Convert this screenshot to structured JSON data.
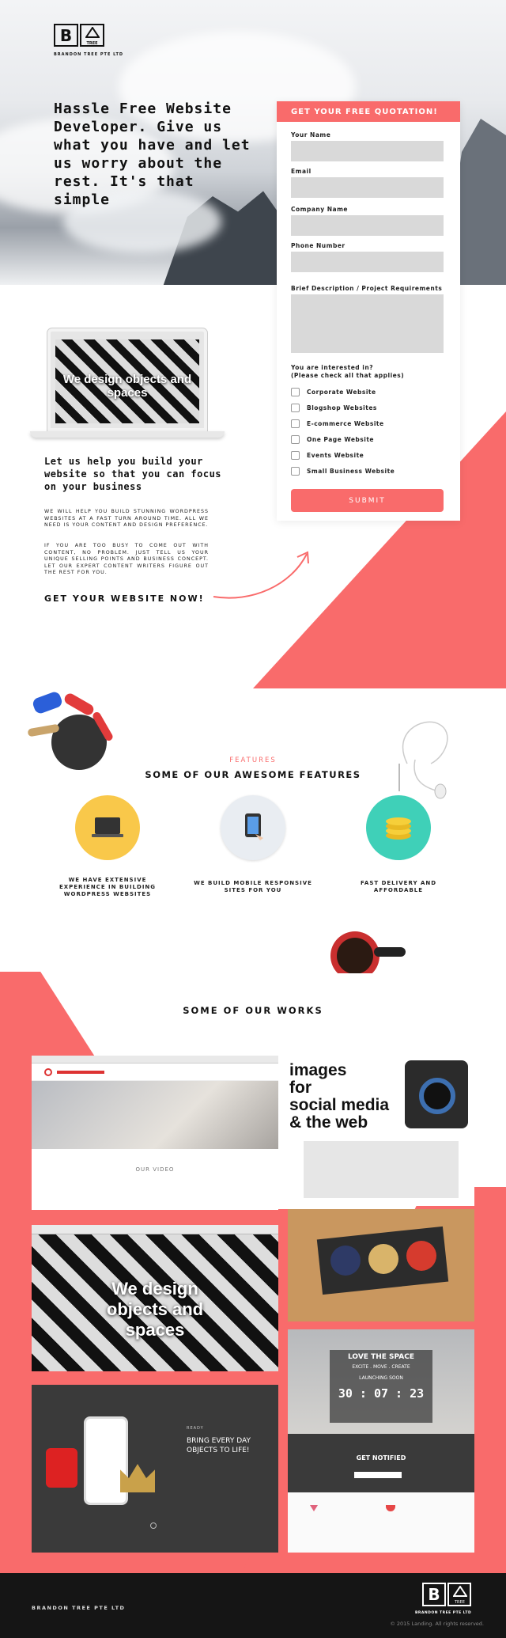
{
  "brand": {
    "logo_b": "B",
    "logo_a": "A",
    "logo_tree": "TREE",
    "company": "BRANDON TREE PTE LTD"
  },
  "hero": {
    "headline": "Hassle Free Website Developer. Give us what you have and let us worry about the rest. It's that simple"
  },
  "form": {
    "title": "GET YOUR FREE QUOTATION!",
    "labels": {
      "name": "Your Name",
      "email": "Email",
      "company": "Company Name",
      "phone": "Phone Number",
      "brief": "Brief Description / Project Requirements"
    },
    "interest_label": "You are interested in?",
    "interest_hint": "(Please check all that applies)",
    "options": [
      "Corporate Website",
      "Blogshop Websites",
      "E-commerce Website",
      "One Page Website",
      "Events Website",
      "Small Business Website"
    ],
    "submit": "SUBMIT"
  },
  "laptop": {
    "screen_text": "We design objects and spaces"
  },
  "intro": {
    "heading": "Let us help you build your website so that you can focus on your business",
    "p1": "WE WILL HELP YOU BUILD STUNNING WORDPRESS WEBSITES AT A FAST TURN AROUND TIME. ALL WE NEED IS YOUR CONTENT AND DESIGN PREFERENCE.",
    "p2": "IF YOU ARE TOO BUSY TO COME OUT WITH CONTENT, NO PROBLEM. JUST TELL US YOUR UNIQUE SELLING POINTS AND BUSINESS CONCEPT. LET OUR EXPERT CONTENT WRITERS FIGURE OUT THE REST FOR YOU.",
    "cta": "GET YOUR WEBSITE NOW!"
  },
  "features": {
    "kicker": "FEATURES",
    "title": "SOME OF OUR AWESOME FEATURES",
    "items": [
      {
        "caption": "WE HAVE EXTENSIVE EXPERIENCE IN BUILDING WORDPRESS WEBSITES",
        "icon": "laptop-icon",
        "color": "#f9c84a"
      },
      {
        "caption": "WE BUILD MOBILE RESPONSIVE SITES FOR YOU",
        "icon": "tablet-icon",
        "color": "#e9edf2"
      },
      {
        "caption": "FAST DELIVERY AND AFFORDABLE",
        "icon": "coins-icon",
        "color": "#3fd0b8"
      }
    ]
  },
  "works": {
    "title": "SOME OF OUR WORKS",
    "shot1": {
      "video_label": "OUR VIDEO"
    },
    "shot2": {
      "text": "We design objects and spaces"
    },
    "shot3": {
      "kicker": "READY",
      "line1": "BRING EVERY DAY",
      "line2": "OBJECTS TO LIFE!"
    },
    "shot4": {
      "line1": "images",
      "line2": "for",
      "line3": "social media",
      "line4": "& the web"
    },
    "shot5": {
      "title": "LOVE THE SPACE",
      "sub": "EXCITE . MOVE . CREATE",
      "soon": "LAUNCHING SOON",
      "timer": "30 : 07 : 23",
      "notify": "GET NOTIFIED"
    }
  },
  "footer": {
    "left": "BRANDON TREE PTE LTD",
    "copyright": "© 2015 Landing. All rights reserved."
  },
  "colors": {
    "accent": "#f96b6b",
    "dark": "#151515"
  }
}
